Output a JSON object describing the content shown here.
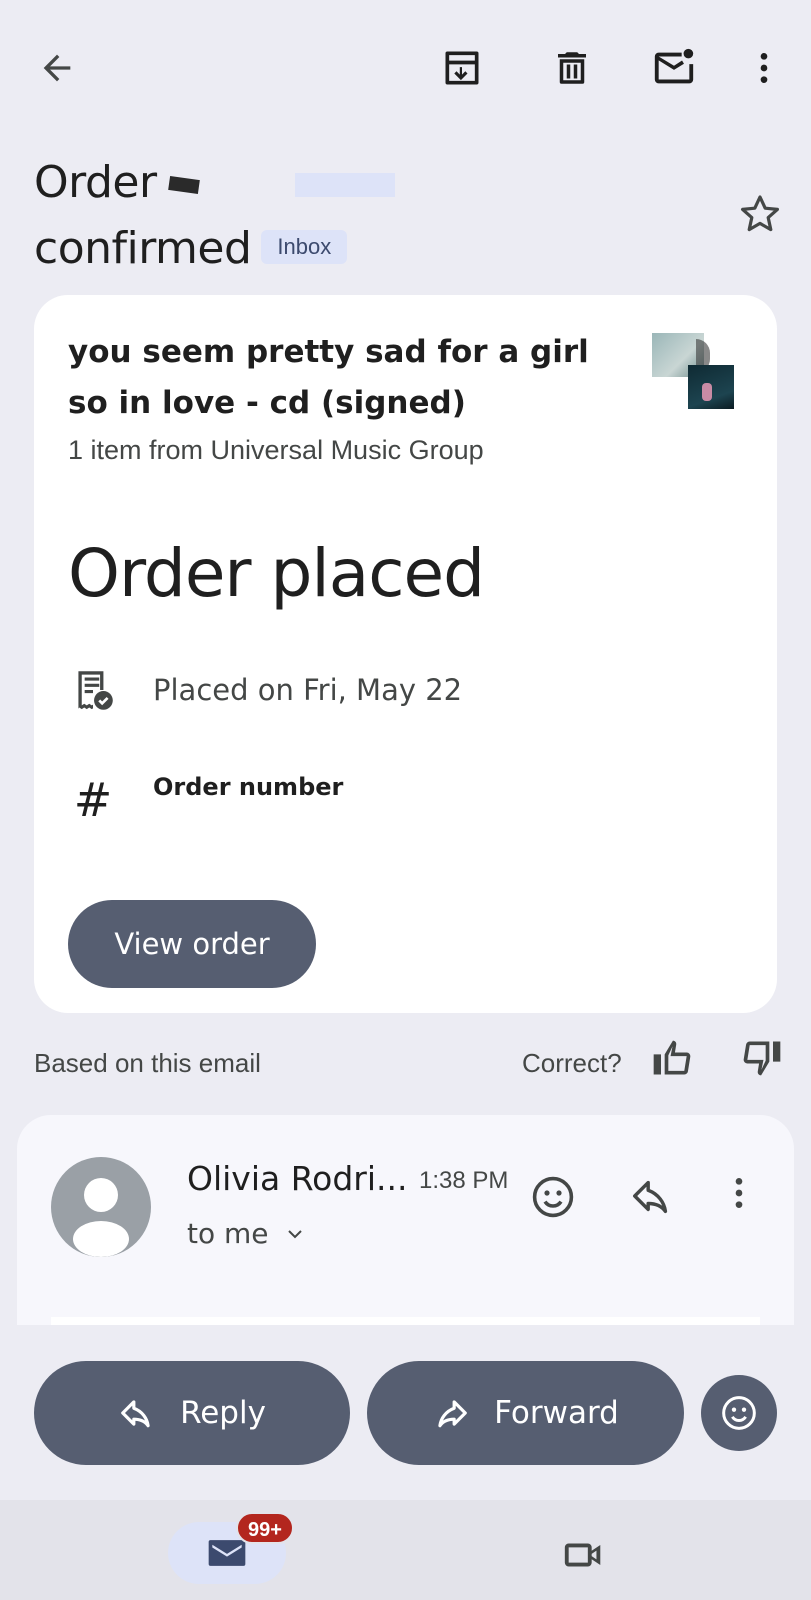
{
  "toolbar": {
    "back_icon": "arrow-back-icon",
    "archive_icon": "archive-icon",
    "delete_icon": "trash-icon",
    "mark_unread_icon": "mark-unread-icon",
    "more_icon": "more-vert-icon"
  },
  "email": {
    "subject_line1": "Order",
    "subject_line2": "confirmed",
    "label": "Inbox",
    "starred": false
  },
  "order_card": {
    "item_title": "you seem pretty sad for a girl so in love - cd (signed)",
    "item_subtitle": "1 item from Universal Music Group",
    "status": "Order placed",
    "placed_on": "Placed on Fri, May 22",
    "order_number_label": "Order number",
    "order_number_icon": "#",
    "view_order_label": "View order"
  },
  "feedback": {
    "based_on": "Based on this email",
    "correct": "Correct?"
  },
  "message": {
    "sender": "Olivia Rodri...",
    "time": "1:38 PM",
    "recipient": "to me"
  },
  "actions": {
    "reply_label": "Reply",
    "forward_label": "Forward"
  },
  "bottom_nav": {
    "mail_badge": "99+"
  },
  "colors": {
    "background": "#ECECF3",
    "card": "#FFFFFF",
    "button": "#565E71",
    "badge": "#B3261E",
    "label_chip": "#DDE3F8"
  }
}
